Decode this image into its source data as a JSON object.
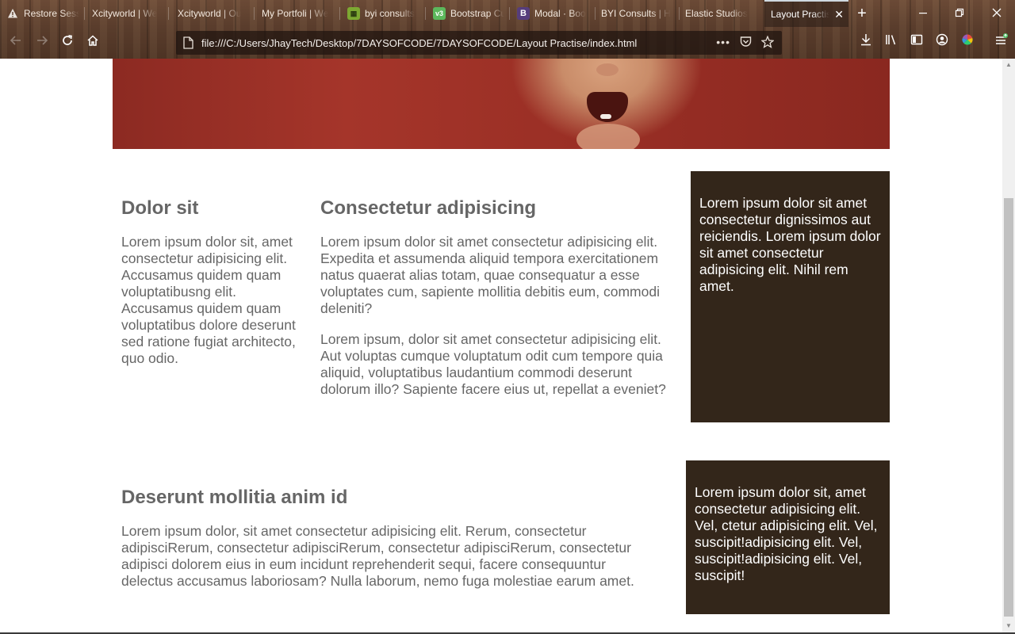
{
  "browser": {
    "tabs": [
      {
        "title": "Restore Session",
        "favicon": "warning-icon"
      },
      {
        "title": "Xcityworld | We",
        "favicon": "none"
      },
      {
        "title": "Xcityworld | Ou",
        "favicon": "none"
      },
      {
        "title": "My Portfoli | We",
        "favicon": "none"
      },
      {
        "title": "byi consults",
        "favicon": "byi-icon"
      },
      {
        "title": "Bootstrap Cu",
        "favicon": "bootstrap-customize-icon"
      },
      {
        "title": "Modal · Boo",
        "favicon": "bootstrap-icon"
      },
      {
        "title": "BYI Consults | H",
        "favicon": "none"
      },
      {
        "title": "Elastic Studios",
        "favicon": "none"
      },
      {
        "title": "Layout Practis",
        "favicon": "none",
        "active": true
      }
    ],
    "url": "file:///C:/Users/JhayTech/Desktop/7DAYSOFCODE/7DAYSOFCODE/Layout Practise/index.html",
    "icons": {
      "back": "back-arrow-icon",
      "forward": "forward-arrow-icon",
      "reload": "reload-icon",
      "home": "home-icon",
      "page_actions": "more-dots-icon",
      "pocket": "pocket-icon",
      "bookmark": "star-icon",
      "downloads": "download-icon",
      "library": "library-icon",
      "sidebar": "sidebar-icon",
      "account": "account-icon",
      "color": "color-wheel-icon",
      "menu": "hamburger-menu-icon"
    },
    "colors": {
      "active_tab_border": "#cfd8e0"
    }
  },
  "page": {
    "section1": {
      "col1": {
        "heading": "Dolor sit",
        "text": "Lorem ipsum dolor sit, amet consectetur adipisicing elit. Accusamus quidem quam voluptatibusng elit. Accusamus quidem quam voluptatibus dolore deserunt sed ratione fugiat architecto, quo odio."
      },
      "col2": {
        "heading": "Consectetur adipisicing",
        "text1": "Lorem ipsum dolor sit amet consectetur adipisicing elit. Expedita et assumenda aliquid tempora exercitationem natus quaerat alias totam, quae consequatur a esse voluptates cum, sapiente mollitia debitis eum, commodi deleniti?",
        "text2": "Lorem ipsum, dolor sit amet consectetur adipisicing elit. Aut voluptas cumque voluptatum odit cum tempore quia aliquid, voluptatibus laudantium commodi deserunt dolorum illo? Sapiente facere eius ut, repellat a eveniet?"
      },
      "aside": {
        "text": "Lorem ipsum dolor sit amet consectetur dignissimos aut reiciendis. Lorem ipsum dolor sit amet consectetur adipisicing elit. Nihil rem amet."
      }
    },
    "section2": {
      "heading": "Deserunt mollitia anim id",
      "text": "Lorem ipsum dolor, sit amet consectetur adipisicing elit. Rerum, consectetur adipisciRerum, consectetur adipisciRerum, consectetur adipisciRerum, consectetur adipisci dolorem eius in eum incidunt reprehenderit sequi, facere consequuntur delectus accusamus laboriosam? Nulla laborum, nemo fuga molestiae earum amet.",
      "aside": {
        "text": "Lorem ipsum dolor sit, amet consectetur adipisicing elit. Vel, ctetur adipisicing elit. Vel, suscipit!adipisicing elit. Vel, suscipit!adipisicing elit. Vel, suscipit!"
      }
    },
    "colors": {
      "text": "#666666",
      "dark_box": "#33261a",
      "hero_red": "#9a2f25"
    }
  }
}
